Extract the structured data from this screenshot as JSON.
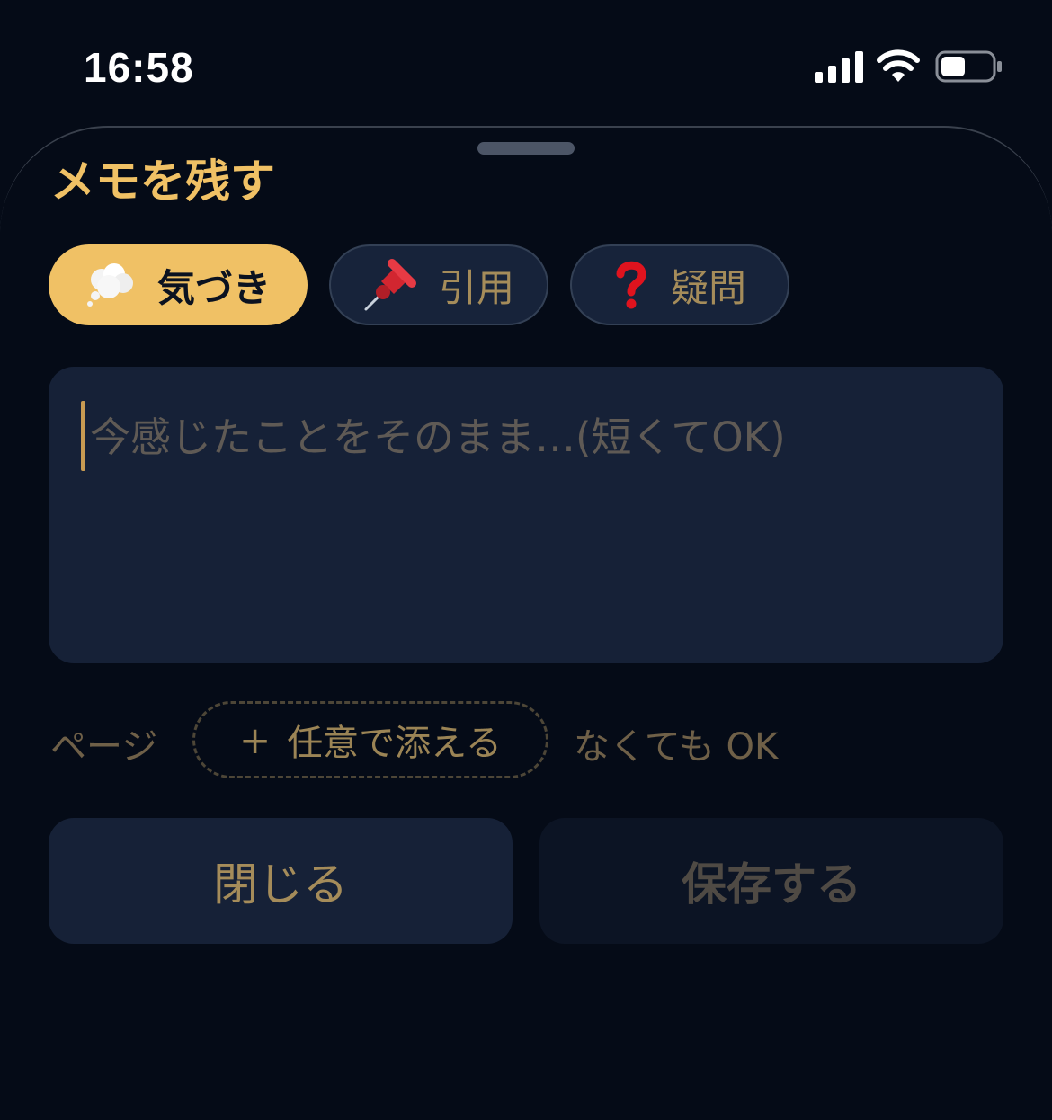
{
  "status_bar": {
    "time": "16:58",
    "icons": [
      "signal-icon",
      "wifi-icon",
      "battery-icon"
    ]
  },
  "sheet": {
    "title": "メモを残す",
    "types": [
      {
        "emoji": "thought-bubble-icon",
        "label": "気づき",
        "selected": true
      },
      {
        "emoji": "pushpin-icon",
        "label": "引用",
        "selected": false
      },
      {
        "emoji": "question-mark-icon",
        "label": "疑問",
        "selected": false
      }
    ],
    "memo": {
      "value": "",
      "placeholder": "今感じたことをそのまま…(短くてOK)"
    },
    "page": {
      "label": "ページ",
      "add_label": "任意で添える",
      "hint": "なくても OK"
    },
    "actions": {
      "close_label": "閉じる",
      "save_label": "保存する"
    }
  },
  "colors": {
    "background": "#050b17",
    "accent": "#f0c165",
    "panel": "#162137"
  }
}
